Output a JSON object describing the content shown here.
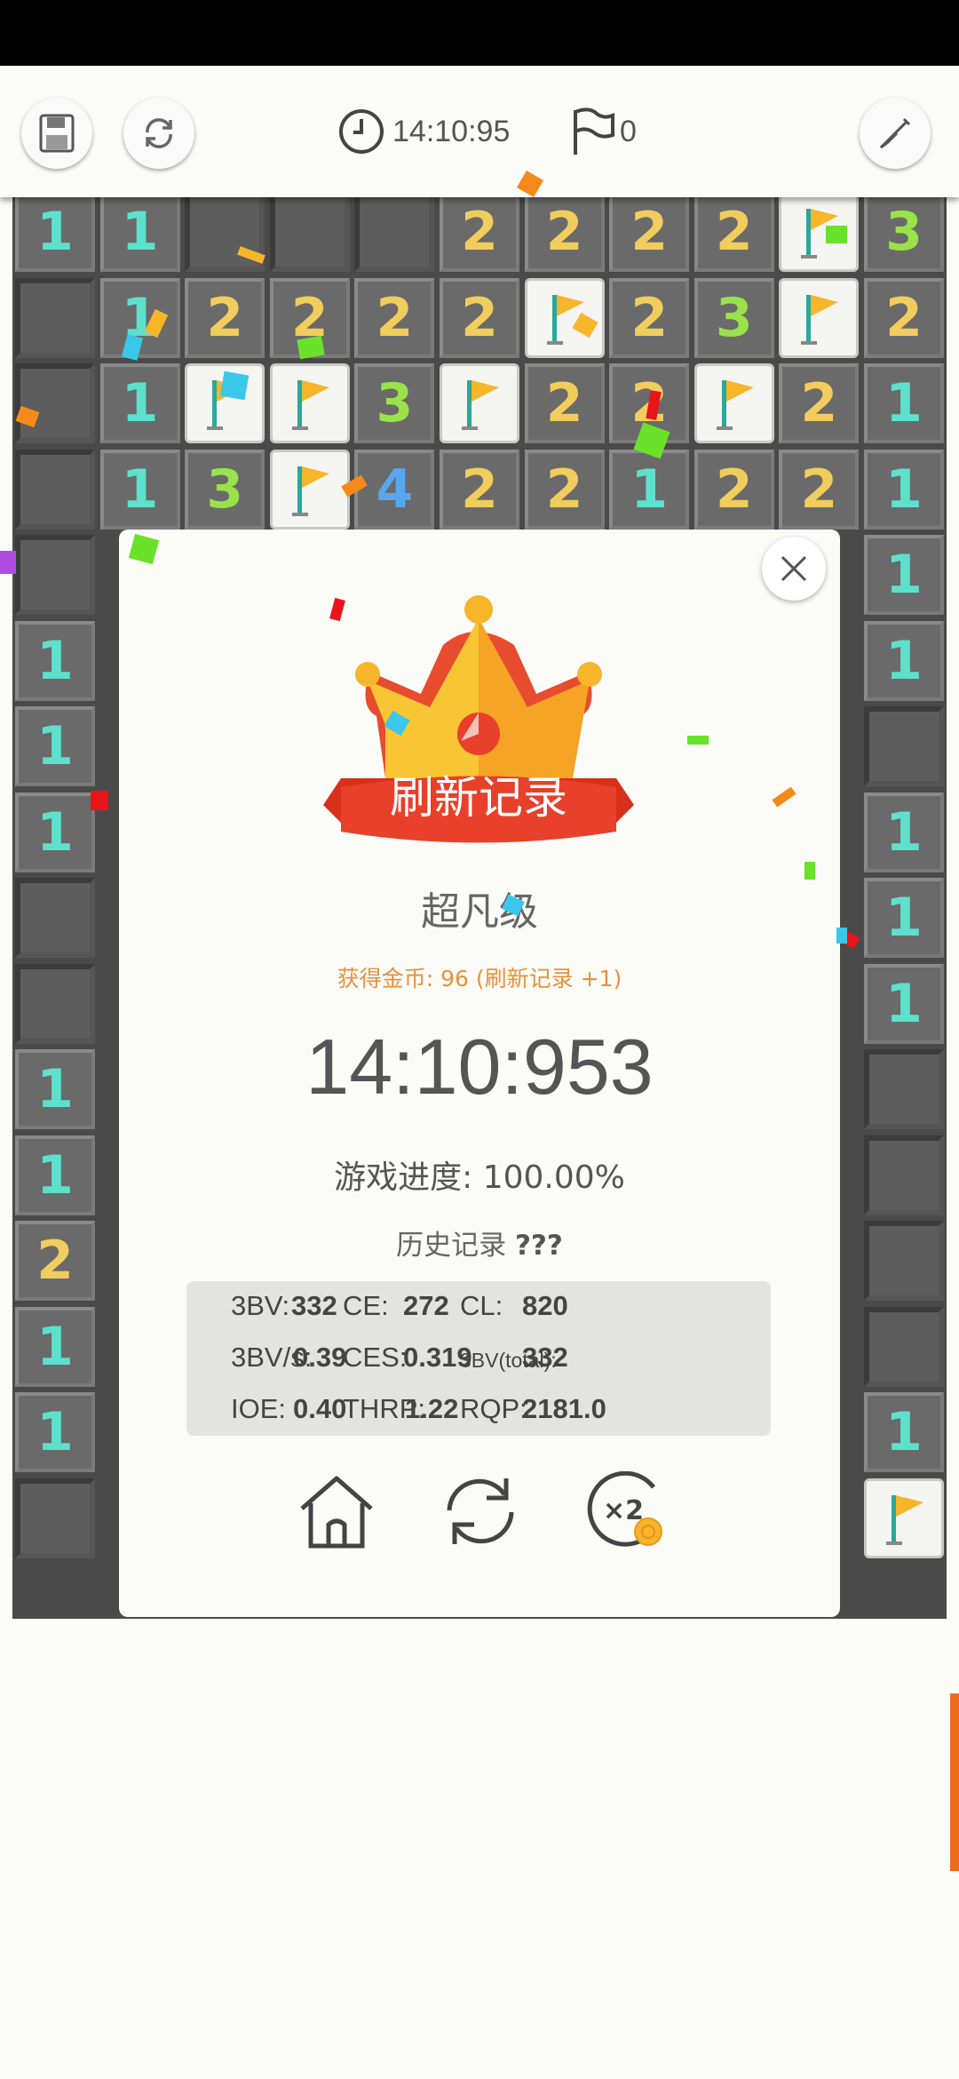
{
  "topbar": {
    "save_icon": "save-icon",
    "restart_icon": "refresh-icon",
    "timer_icon": "clock-icon",
    "timer_value": "14:10:95",
    "flag_icon": "flag-icon",
    "flag_count": "0",
    "shovel_icon": "shovel-icon"
  },
  "board": {
    "rows": [
      [
        "1",
        "1",
        "H",
        "H",
        "H",
        "2",
        "2",
        "2",
        "2",
        "F",
        "3"
      ],
      [
        "H",
        "1",
        "2",
        "2",
        "2",
        "2",
        "F",
        "2",
        "3",
        "F",
        "2"
      ],
      [
        "H",
        "1",
        "F",
        "F",
        "3",
        "F",
        "2",
        "2",
        "F",
        "2",
        "1"
      ],
      [
        "H",
        "1",
        "3",
        "F",
        "4",
        "2",
        "2",
        "1",
        "2",
        "2",
        "1"
      ],
      [
        "H",
        "",
        "",
        "",
        "",
        "",
        "",
        "",
        "",
        "",
        "1"
      ],
      [
        "1",
        "",
        "",
        "",
        "",
        "",
        "",
        "",
        "",
        "",
        "1"
      ],
      [
        "1",
        "",
        "",
        "",
        "",
        "",
        "",
        "",
        "",
        "",
        "H"
      ],
      [
        "1",
        "",
        "",
        "",
        "",
        "",
        "",
        "",
        "",
        "",
        "1"
      ],
      [
        "H",
        "",
        "",
        "",
        "",
        "",
        "",
        "",
        "",
        "",
        "1"
      ],
      [
        "H",
        "",
        "",
        "",
        "",
        "",
        "",
        "",
        "",
        "",
        "1"
      ],
      [
        "1",
        "",
        "",
        "",
        "",
        "",
        "",
        "",
        "",
        "",
        "H"
      ],
      [
        "1",
        "",
        "",
        "",
        "",
        "",
        "",
        "",
        "",
        "",
        "H"
      ],
      [
        "2",
        "",
        "",
        "",
        "",
        "",
        "",
        "",
        "",
        "",
        "H"
      ],
      [
        "1",
        "",
        "",
        "",
        "",
        "",
        "",
        "",
        "",
        "",
        "H"
      ],
      [
        "1",
        "",
        "",
        "",
        "",
        "",
        "",
        "",
        "",
        "",
        "1"
      ],
      [
        "H",
        "",
        "",
        "",
        "",
        "",
        "",
        "",
        "",
        "",
        "F"
      ]
    ]
  },
  "modal": {
    "close_icon": "close-icon",
    "banner_text": "刷新记录",
    "level": "超凡级",
    "coins": "获得金币: 96 (刷新记录 +1)",
    "time": "14:10:953",
    "progress": "游戏进度: 100.00%",
    "history_label": "历史记录",
    "history_value": "???",
    "stats": {
      "bv3_label": "3BV:",
      "bv3": "332",
      "ce_label": "CE:",
      "ce": "272",
      "cl_label": "CL:",
      "cl": "820",
      "bvs_label": "3BV/s:",
      "bvs": "0.39",
      "ces_label": "CES:",
      "ces": "0.319",
      "bvtotal_label": "3BV(total):",
      "bvtotal": "332",
      "ioe_label": "IOE:",
      "ioe": "0.40",
      "thrp_label": "THRP:",
      "thrp": "1.22",
      "rqp_label": "RQP:",
      "rqp": "2181.0"
    },
    "actions": {
      "home_icon": "home-icon",
      "retry_icon": "refresh-icon",
      "double_icon": "x2-coin-icon",
      "double_label": "×2"
    }
  },
  "colors": {
    "accent_orange": "#e8923a",
    "banner_red": "#e33c1a",
    "crown_gold": "#f7b52a",
    "board_dark": "#4a4a4a"
  }
}
